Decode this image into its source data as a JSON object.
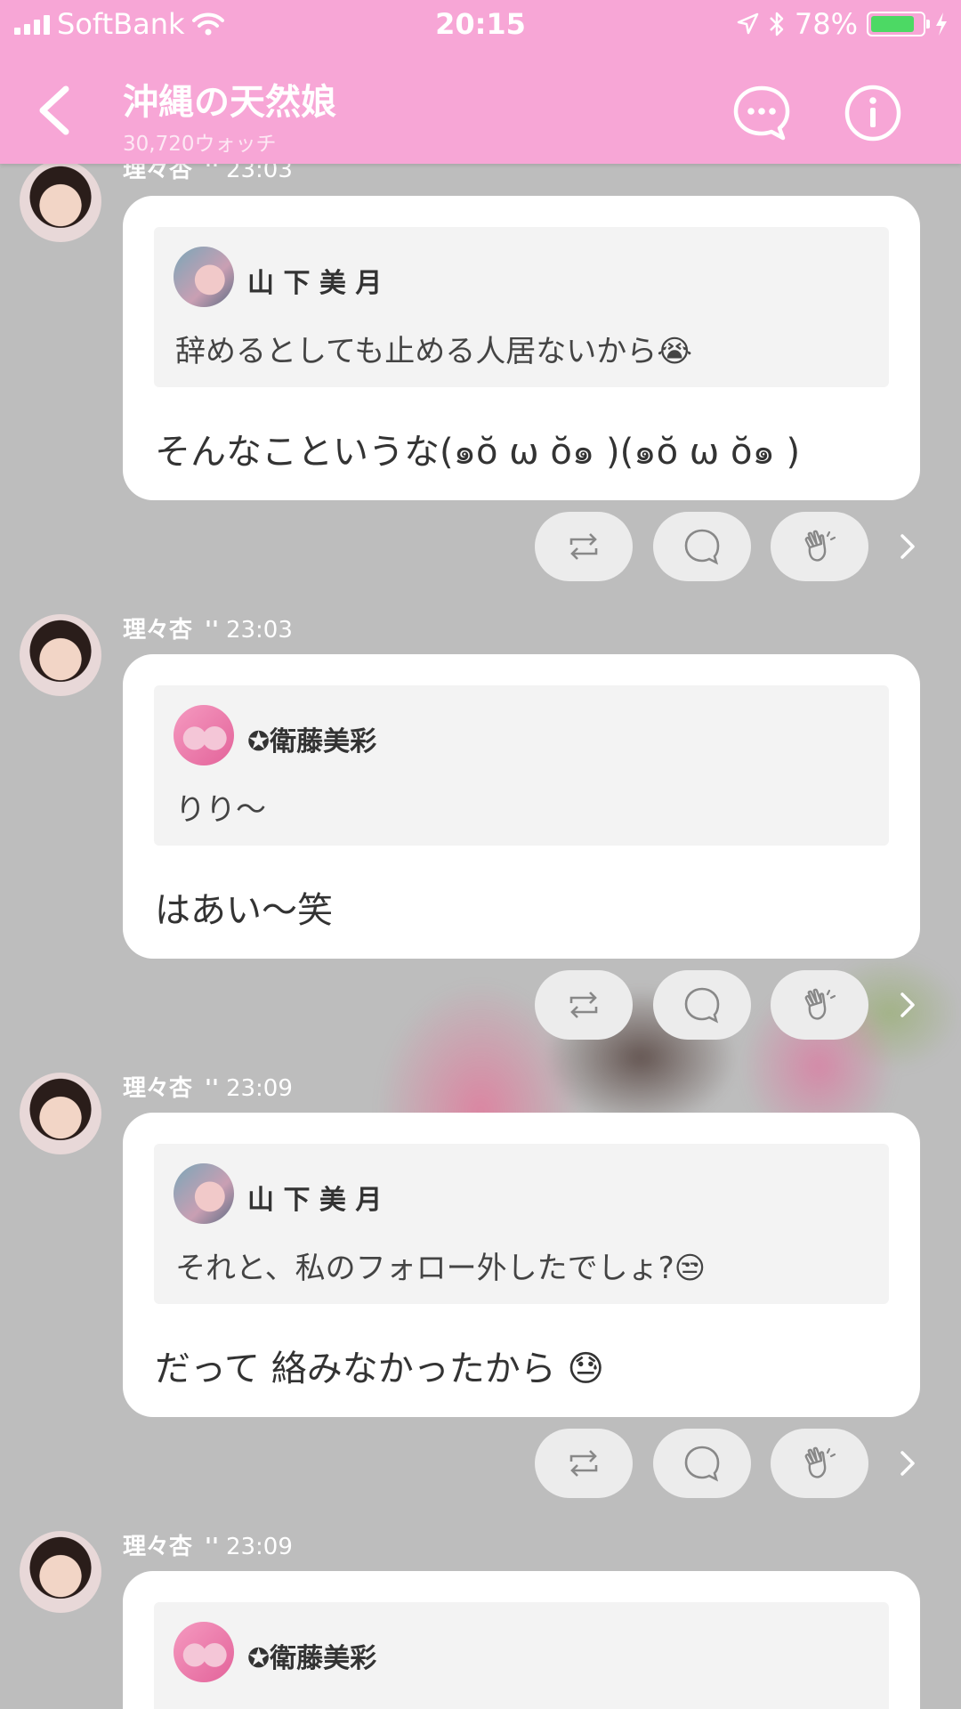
{
  "status_bar": {
    "carrier": "SoftBank",
    "time": "20:15",
    "battery": "78%"
  },
  "header": {
    "title": "沖縄の天然娘",
    "subtitle": "30,720ウォッチ"
  },
  "posts": [
    {
      "author": "理々杏",
      "mark": "''",
      "time": "23:03",
      "quote": {
        "name": "山 下 美 月",
        "text": "辞めるとしても止める人居ないから😭"
      },
      "body": "そんなこというな(๑ŏ ω ŏ๑ )(๑ŏ ω ŏ๑ )"
    },
    {
      "author": "理々杏",
      "mark": "''",
      "time": "23:03",
      "quote": {
        "name": "✪衛藤美彩",
        "text": "りり〜"
      },
      "body": "はあい〜笑"
    },
    {
      "author": "理々杏",
      "mark": "''",
      "time": "23:09",
      "quote": {
        "name": "山 下 美 月",
        "text": "それと、私のフォロー外したでしょ?😒"
      },
      "body": "だって 絡みなかったから 😓"
    },
    {
      "author": "理々杏",
      "mark": "''",
      "time": "23:09",
      "quote": {
        "name": "✪衛藤美彩",
        "text": ""
      },
      "body": ""
    }
  ],
  "icons": {
    "back": "chevron-left-icon",
    "chat": "chat-bubble-dots-icon",
    "info": "info-icon",
    "repost": "repost-icon",
    "comment": "comment-icon",
    "clap": "clap-icon",
    "more": "chevron-right-icon"
  },
  "colors": {
    "header": "#f7a6d6",
    "background": "#bdbdbd",
    "card": "#ffffff",
    "quote_bg": "#f3f3f3",
    "battery": "#4cd964"
  }
}
